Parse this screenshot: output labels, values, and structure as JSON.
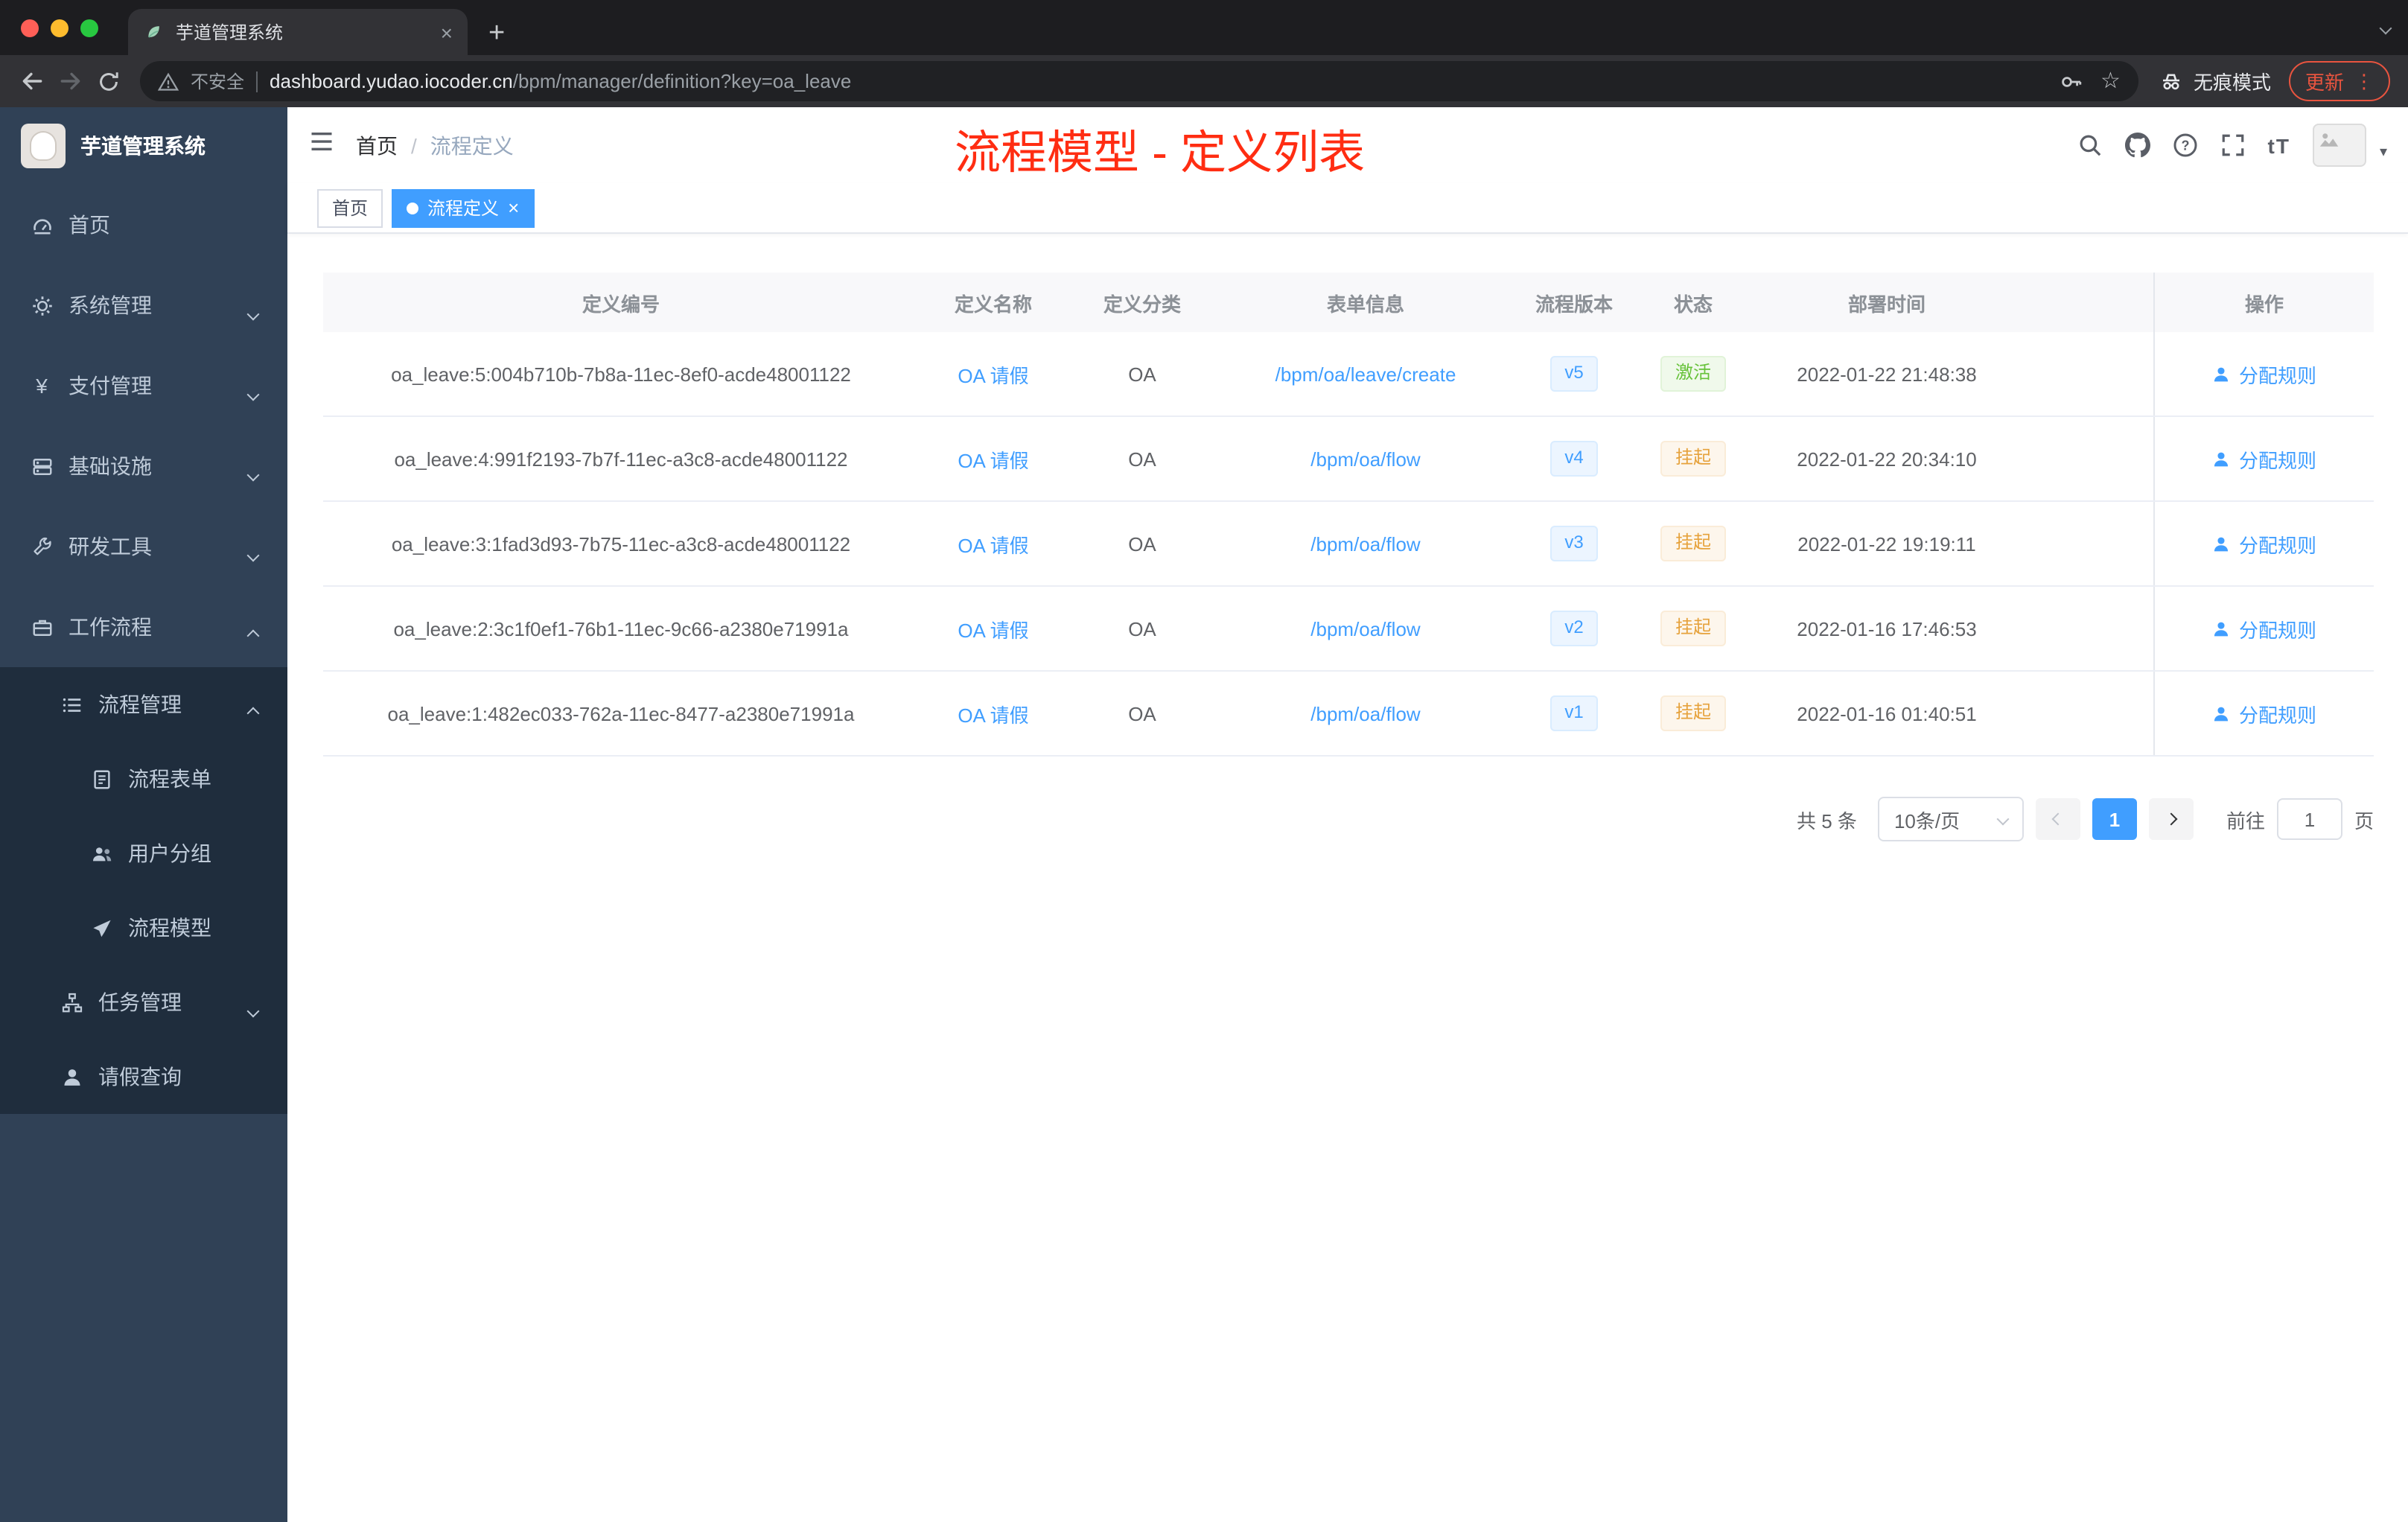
{
  "browser": {
    "tab_title": "芋道管理系统",
    "security_label": "不安全",
    "url_domain": "dashboard.yudao.iocoder.cn",
    "url_path": "/bpm/manager/definition?key=oa_leave",
    "incognito_label": "无痕模式",
    "update_label": "更新"
  },
  "sidebar": {
    "logo_title": "芋道管理系统",
    "items": [
      {
        "label": "首页"
      },
      {
        "label": "系统管理"
      },
      {
        "label": "支付管理"
      },
      {
        "label": "基础设施"
      },
      {
        "label": "研发工具"
      },
      {
        "label": "工作流程"
      },
      {
        "label": "流程管理"
      },
      {
        "label": "流程表单"
      },
      {
        "label": "用户分组"
      },
      {
        "label": "流程模型"
      },
      {
        "label": "任务管理"
      },
      {
        "label": "请假查询"
      }
    ]
  },
  "header": {
    "breadcrumb_home": "首页",
    "breadcrumb_sep": "/",
    "breadcrumb_current": "流程定义",
    "annotation": "流程模型 - 定义列表",
    "font_size_tool": "tT"
  },
  "tags": {
    "home": "首页",
    "active": "流程定义"
  },
  "table": {
    "columns": [
      "定义编号",
      "定义名称",
      "定义分类",
      "表单信息",
      "流程版本",
      "状态",
      "部署时间",
      "操作"
    ],
    "rows": [
      {
        "id": "oa_leave:5:004b710b-7b8a-11ec-8ef0-acde48001122",
        "name": "OA 请假",
        "category": "OA",
        "form": "/bpm/oa/leave/create",
        "version": "v5",
        "status": "激活",
        "time": "2022-01-22 21:48:38",
        "action": "分配规则"
      },
      {
        "id": "oa_leave:4:991f2193-7b7f-11ec-a3c8-acde48001122",
        "name": "OA 请假",
        "category": "OA",
        "form": "/bpm/oa/flow",
        "version": "v4",
        "status": "挂起",
        "time": "2022-01-22 20:34:10",
        "action": "分配规则"
      },
      {
        "id": "oa_leave:3:1fad3d93-7b75-11ec-a3c8-acde48001122",
        "name": "OA 请假",
        "category": "OA",
        "form": "/bpm/oa/flow",
        "version": "v3",
        "status": "挂起",
        "time": "2022-01-22 19:19:11",
        "action": "分配规则"
      },
      {
        "id": "oa_leave:2:3c1f0ef1-76b1-11ec-9c66-a2380e71991a",
        "name": "OA 请假",
        "category": "OA",
        "form": "/bpm/oa/flow",
        "version": "v2",
        "status": "挂起",
        "time": "2022-01-16 17:46:53",
        "action": "分配规则"
      },
      {
        "id": "oa_leave:1:482ec033-762a-11ec-8477-a2380e71991a",
        "name": "OA 请假",
        "category": "OA",
        "form": "/bpm/oa/flow",
        "version": "v1",
        "status": "挂起",
        "time": "2022-01-16 01:40:51",
        "action": "分配规则"
      }
    ]
  },
  "pagination": {
    "total": "共 5 条",
    "page_size": "10条/页",
    "current": "1",
    "goto_label": "前往",
    "goto_value": "1",
    "unit": "页"
  },
  "colors": {
    "accent": "#409eff",
    "success": "#67c23a",
    "warning": "#e6a23c",
    "annotation": "#ff2d12",
    "update_badge": "#e9543f",
    "sidebar_bg": "#304156",
    "submenu_bg": "#1f2d3d"
  }
}
